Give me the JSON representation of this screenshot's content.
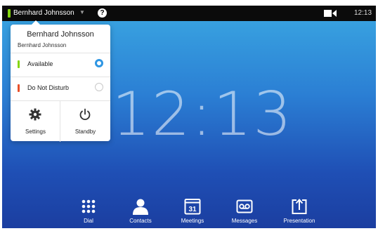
{
  "topbar": {
    "user_name": "Bernhard Johnsson",
    "presence_color": "#84d60d",
    "help_glyph": "?",
    "camera_icon": "camera-icon",
    "time": "12:13"
  },
  "clock": {
    "time": "12:13"
  },
  "status_panel": {
    "name": "Bernhard Johnsson",
    "sub_name": "Bernhard Johnsson",
    "options": [
      {
        "label": "Available",
        "color": "#84d60d",
        "selected": true
      },
      {
        "label": "Do Not Disturb",
        "color": "#e8502a",
        "selected": false
      }
    ],
    "actions": [
      {
        "label": "Settings",
        "icon": "gear-icon"
      },
      {
        "label": "Standby",
        "icon": "power-icon"
      }
    ]
  },
  "dock": [
    {
      "label": "Dial",
      "icon": "dialpad-icon"
    },
    {
      "label": "Contacts",
      "icon": "person-icon"
    },
    {
      "label": "Meetings",
      "icon": "calendar-icon",
      "calendar_day": "31"
    },
    {
      "label": "Messages",
      "icon": "voicemail-icon"
    },
    {
      "label": "Presentation",
      "icon": "share-icon"
    }
  ],
  "colors": {
    "accent": "#2f96e3",
    "background_top": "#3aa7e2",
    "background_bottom": "#1b3ea0"
  }
}
